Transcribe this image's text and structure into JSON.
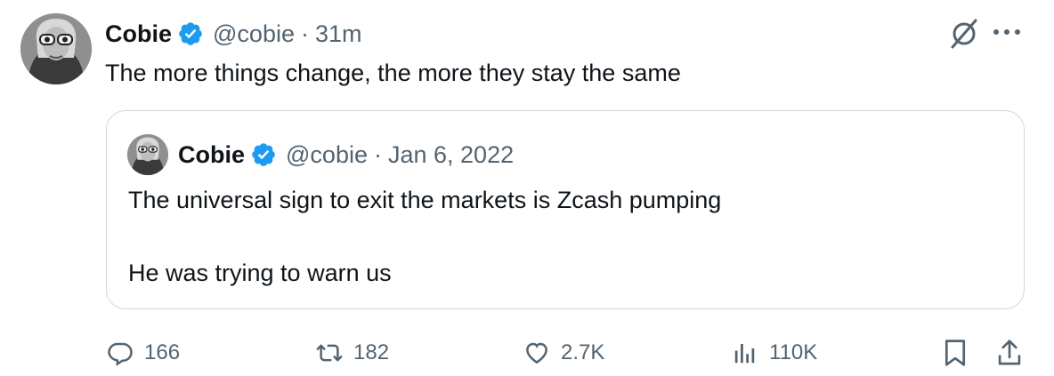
{
  "tweet": {
    "author_name": "Cobie",
    "handle": "@cobie",
    "separator": "·",
    "time": "31m",
    "text": "The more things change, the more they stay the same"
  },
  "quote": {
    "author_name": "Cobie",
    "handle": "@cobie",
    "separator": "·",
    "date": "Jan 6, 2022",
    "line1": "The universal sign to exit the markets is Zcash pumping",
    "line2": "He was trying to warn us"
  },
  "actions": {
    "replies": "166",
    "retweets": "182",
    "likes": "2.7K",
    "views": "110K"
  },
  "icons": {
    "verified": "verified-badge-icon",
    "grok": "grok-icon",
    "more": "more-icon",
    "reply": "reply-icon",
    "retweet": "retweet-icon",
    "like": "heart-icon",
    "views": "views-icon",
    "bookmark": "bookmark-icon",
    "share": "share-icon"
  },
  "colors": {
    "verified_blue": "#1d9bf0",
    "text": "#0f1419",
    "secondary": "#536471",
    "border": "#cfd9de"
  }
}
